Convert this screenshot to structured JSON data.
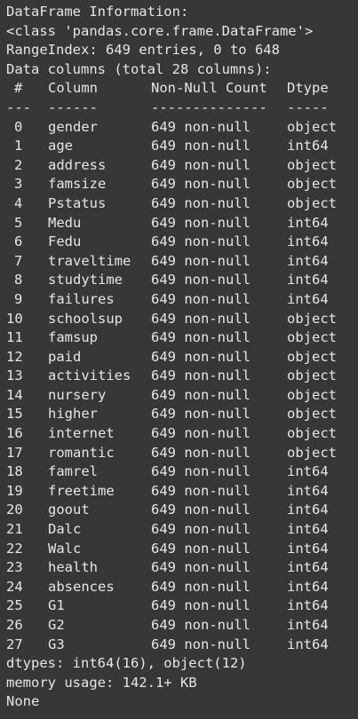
{
  "output": {
    "title": "DataFrame Information:",
    "class_line": "<class 'pandas.core.frame.DataFrame'>",
    "range_index": "RangeIndex: 649 entries, 0 to 648",
    "data_columns": "Data columns (total 28 columns):",
    "header": {
      "idx": "#",
      "column": "Column",
      "count": "Non-Null Count",
      "dtype": "Dtype"
    },
    "separator": {
      "idx": "---",
      "column": "------",
      "count": "--------------",
      "dtype": "-----"
    },
    "rows": [
      {
        "idx": "0",
        "column": "gender",
        "count": "649 non-null",
        "dtype": "object"
      },
      {
        "idx": "1",
        "column": "age",
        "count": "649 non-null",
        "dtype": "int64"
      },
      {
        "idx": "2",
        "column": "address",
        "count": "649 non-null",
        "dtype": "object"
      },
      {
        "idx": "3",
        "column": "famsize",
        "count": "649 non-null",
        "dtype": "object"
      },
      {
        "idx": "4",
        "column": "Pstatus",
        "count": "649 non-null",
        "dtype": "object"
      },
      {
        "idx": "5",
        "column": "Medu",
        "count": "649 non-null",
        "dtype": "int64"
      },
      {
        "idx": "6",
        "column": "Fedu",
        "count": "649 non-null",
        "dtype": "int64"
      },
      {
        "idx": "7",
        "column": "traveltime",
        "count": "649 non-null",
        "dtype": "int64"
      },
      {
        "idx": "8",
        "column": "studytime",
        "count": "649 non-null",
        "dtype": "int64"
      },
      {
        "idx": "9",
        "column": "failures",
        "count": "649 non-null",
        "dtype": "int64"
      },
      {
        "idx": "10",
        "column": "schoolsup",
        "count": "649 non-null",
        "dtype": "object"
      },
      {
        "idx": "11",
        "column": "famsup",
        "count": "649 non-null",
        "dtype": "object"
      },
      {
        "idx": "12",
        "column": "paid",
        "count": "649 non-null",
        "dtype": "object"
      },
      {
        "idx": "13",
        "column": "activities",
        "count": "649 non-null",
        "dtype": "object"
      },
      {
        "idx": "14",
        "column": "nursery",
        "count": "649 non-null",
        "dtype": "object"
      },
      {
        "idx": "15",
        "column": "higher",
        "count": "649 non-null",
        "dtype": "object"
      },
      {
        "idx": "16",
        "column": "internet",
        "count": "649 non-null",
        "dtype": "object"
      },
      {
        "idx": "17",
        "column": "romantic",
        "count": "649 non-null",
        "dtype": "object"
      },
      {
        "idx": "18",
        "column": "famrel",
        "count": "649 non-null",
        "dtype": "int64"
      },
      {
        "idx": "19",
        "column": "freetime",
        "count": "649 non-null",
        "dtype": "int64"
      },
      {
        "idx": "20",
        "column": "goout",
        "count": "649 non-null",
        "dtype": "int64"
      },
      {
        "idx": "21",
        "column": "Dalc",
        "count": "649 non-null",
        "dtype": "int64"
      },
      {
        "idx": "22",
        "column": "Walc",
        "count": "649 non-null",
        "dtype": "int64"
      },
      {
        "idx": "23",
        "column": "health",
        "count": "649 non-null",
        "dtype": "int64"
      },
      {
        "idx": "24",
        "column": "absences",
        "count": "649 non-null",
        "dtype": "int64"
      },
      {
        "idx": "25",
        "column": "G1",
        "count": "649 non-null",
        "dtype": "int64"
      },
      {
        "idx": "26",
        "column": "G2",
        "count": "649 non-null",
        "dtype": "int64"
      },
      {
        "idx": "27",
        "column": "G3",
        "count": "649 non-null",
        "dtype": "int64"
      }
    ],
    "dtypes_line": "dtypes: int64(16), object(12)",
    "memory_line": "memory usage: 142.1+ KB",
    "none_line": "None"
  },
  "colors": {
    "background": "#373737",
    "text": "#e6e6e6"
  }
}
